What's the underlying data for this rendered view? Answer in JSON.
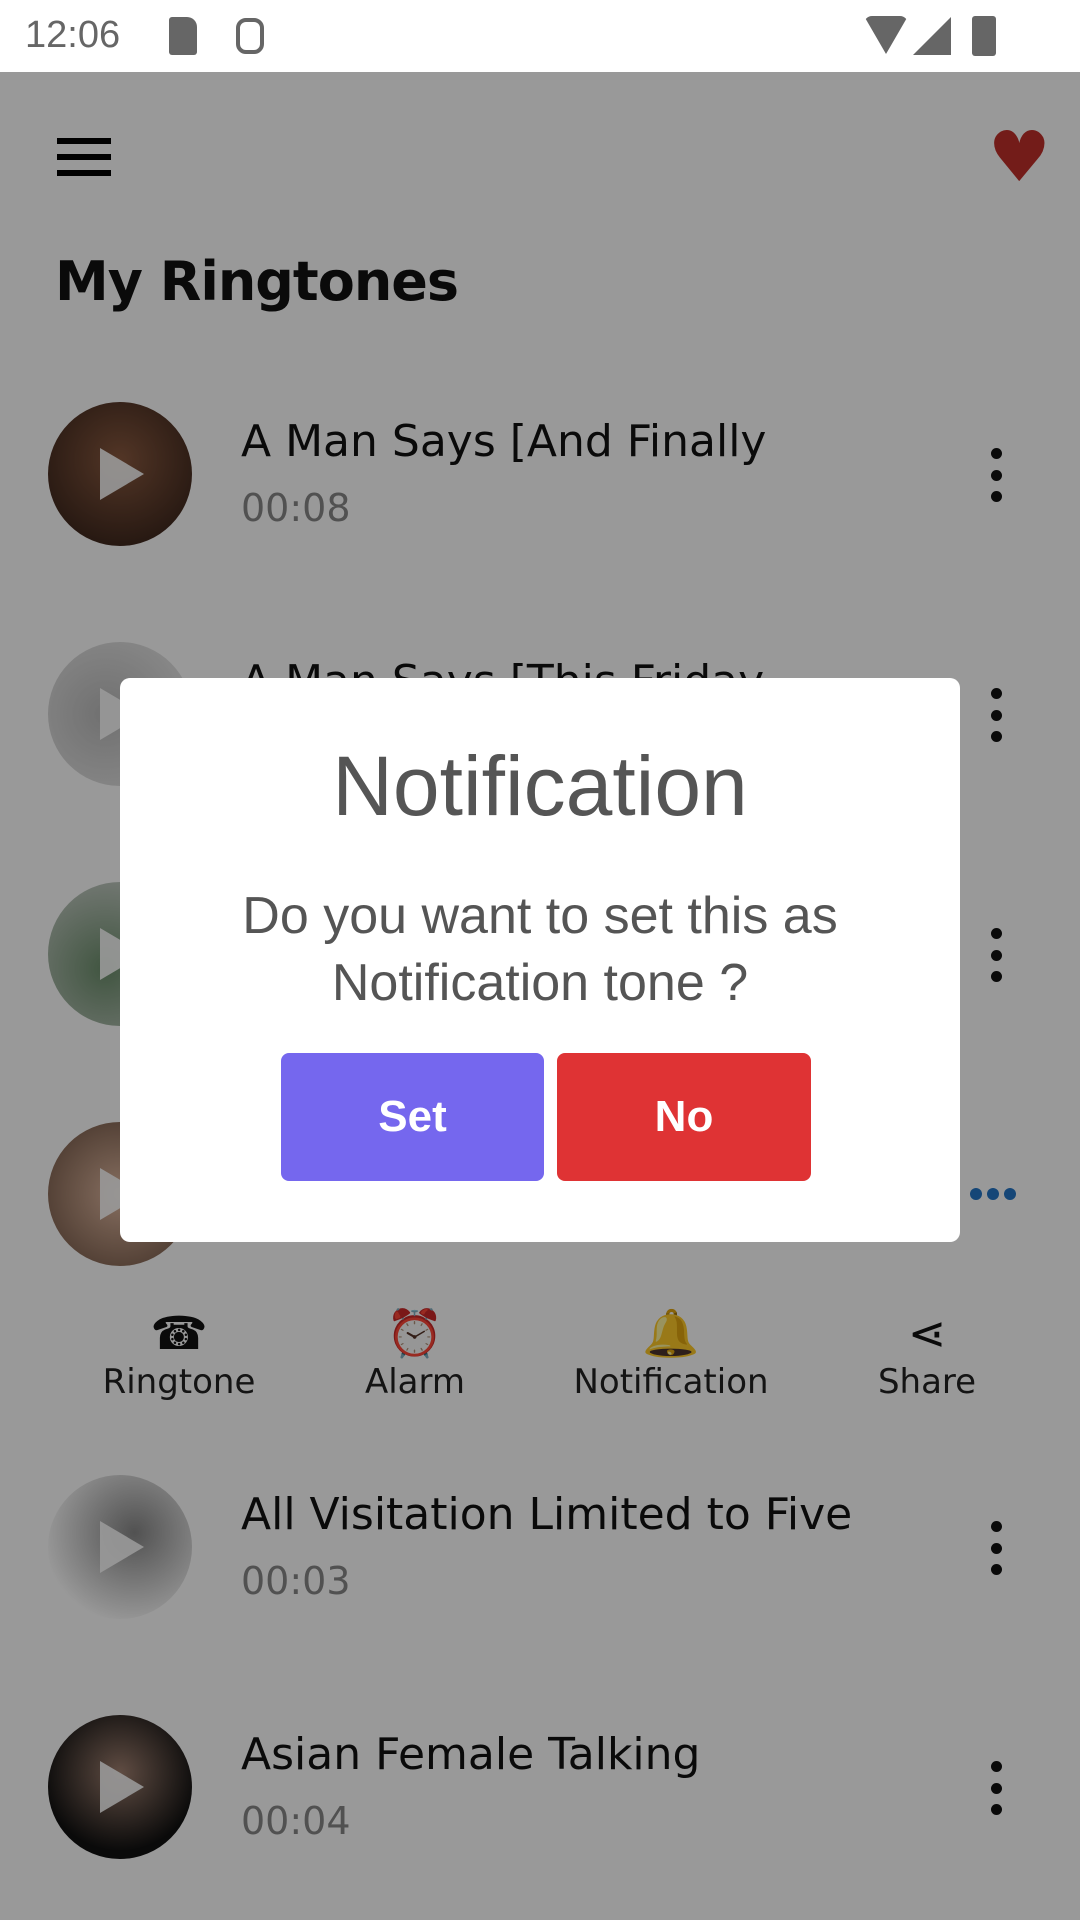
{
  "status_bar": {
    "time": "12:06",
    "icons": [
      "sd-card-icon",
      "android-debug-icon",
      "wifi-icon",
      "signal-icon",
      "battery-icon"
    ]
  },
  "header": {
    "menu_icon": "hamburger-menu-icon",
    "favorite_icon": "heart-icon",
    "title": "My Ringtones"
  },
  "ringtones": [
    {
      "title": "A Man Says [And Finally",
      "duration": "00:08"
    },
    {
      "title": "A Man Says [This Friday",
      "duration": ""
    },
    {
      "title": "",
      "duration": ""
    },
    {
      "title": "",
      "duration": ""
    },
    {
      "title": "All Visitation Limited to Five",
      "duration": "00:03"
    },
    {
      "title": "Asian Female Talking",
      "duration": "00:04"
    }
  ],
  "actions": [
    {
      "icon": "ringtone-phone-icon",
      "label": "Ringtone"
    },
    {
      "icon": "alarm-clock-icon",
      "label": "Alarm"
    },
    {
      "icon": "bell-icon",
      "label": "Notification"
    },
    {
      "icon": "share-icon",
      "label": "Share"
    }
  ],
  "dialog": {
    "title": "Notification",
    "message": "Do you want to set this as Notification tone ?",
    "set_label": "Set",
    "no_label": "No"
  },
  "colors": {
    "set": "#7567ee",
    "no": "#df3334",
    "heart": "#c0302a",
    "expanded_dots": "#2376c7"
  }
}
